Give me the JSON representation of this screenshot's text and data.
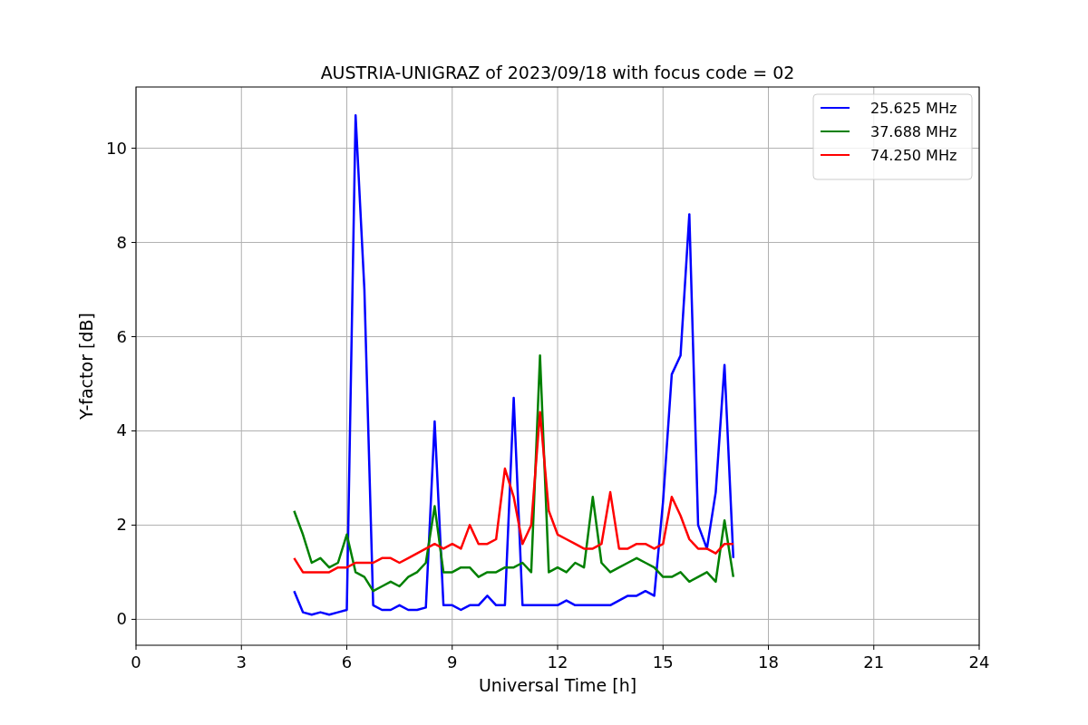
{
  "figure": {
    "chart_data": {
      "type": "line",
      "grid": true,
      "legend": true,
      "title": "AUSTRIA-UNIGRAZ of 2023/09/18 with focus code = 02",
      "xlabel": "Universal Time [h]",
      "ylabel": "Y-factor [dB]",
      "xlim": [
        0,
        24
      ],
      "ylim": [
        -0.55,
        11.3
      ],
      "xticks": [
        0,
        3,
        6,
        9,
        12,
        15,
        18,
        21,
        24
      ],
      "yticks": [
        0,
        2,
        4,
        6,
        8,
        10
      ],
      "x": [
        4.5,
        4.75,
        5,
        5.25,
        5.5,
        5.75,
        6,
        6.25,
        6.5,
        6.75,
        7,
        7.25,
        7.5,
        7.75,
        8,
        8.25,
        8.5,
        8.75,
        9,
        9.25,
        9.5,
        9.75,
        10,
        10.25,
        10.5,
        10.75,
        11,
        11.25,
        11.5,
        11.75,
        12,
        12.25,
        12.5,
        12.75,
        13,
        13.25,
        13.5,
        13.75,
        14,
        14.25,
        14.5,
        14.75,
        15,
        15.25,
        15.5,
        15.75,
        16,
        16.25,
        16.5,
        16.75,
        17
      ],
      "series": [
        {
          "name": "25.625 MHz",
          "color": "#0000ff",
          "values": [
            0.6,
            0.15,
            0.1,
            0.15,
            0.1,
            0.15,
            0.2,
            10.7,
            7.0,
            0.3,
            0.2,
            0.2,
            0.3,
            0.2,
            0.2,
            0.25,
            4.2,
            0.3,
            0.3,
            0.2,
            0.3,
            0.3,
            0.5,
            0.3,
            0.3,
            4.7,
            0.3,
            0.3,
            0.3,
            0.3,
            0.3,
            0.4,
            0.3,
            0.3,
            0.3,
            0.3,
            0.3,
            0.4,
            0.5,
            0.5,
            0.6,
            0.5,
            2.5,
            5.2,
            5.6,
            8.6,
            2.0,
            1.5,
            2.7,
            5.4,
            1.3
          ]
        },
        {
          "name": "37.688 MHz",
          "color": "#008000",
          "values": [
            2.3,
            1.8,
            1.2,
            1.3,
            1.1,
            1.2,
            1.8,
            1.0,
            0.9,
            0.6,
            0.7,
            0.8,
            0.7,
            0.9,
            1.0,
            1.2,
            2.4,
            1.0,
            1.0,
            1.1,
            1.1,
            0.9,
            1.0,
            1.0,
            1.1,
            1.1,
            1.2,
            1.0,
            5.6,
            1.0,
            1.1,
            1.0,
            1.2,
            1.1,
            2.6,
            1.2,
            1.0,
            1.1,
            1.2,
            1.3,
            1.2,
            1.1,
            0.9,
            0.9,
            1.0,
            0.8,
            0.9,
            1.0,
            0.8,
            2.1,
            0.9
          ]
        },
        {
          "name": "74.250 MHz",
          "color": "#ff0000",
          "values": [
            1.3,
            1.0,
            1.0,
            1.0,
            1.0,
            1.1,
            1.1,
            1.2,
            1.2,
            1.2,
            1.3,
            1.3,
            1.2,
            1.3,
            1.4,
            1.5,
            1.6,
            1.5,
            1.6,
            1.5,
            2.0,
            1.6,
            1.6,
            1.7,
            3.2,
            2.6,
            1.6,
            2.0,
            4.4,
            2.3,
            1.8,
            1.7,
            1.6,
            1.5,
            1.5,
            1.6,
            2.7,
            1.5,
            1.5,
            1.6,
            1.6,
            1.5,
            1.6,
            2.6,
            2.2,
            1.7,
            1.5,
            1.5,
            1.4,
            1.6,
            1.6
          ]
        }
      ]
    }
  }
}
